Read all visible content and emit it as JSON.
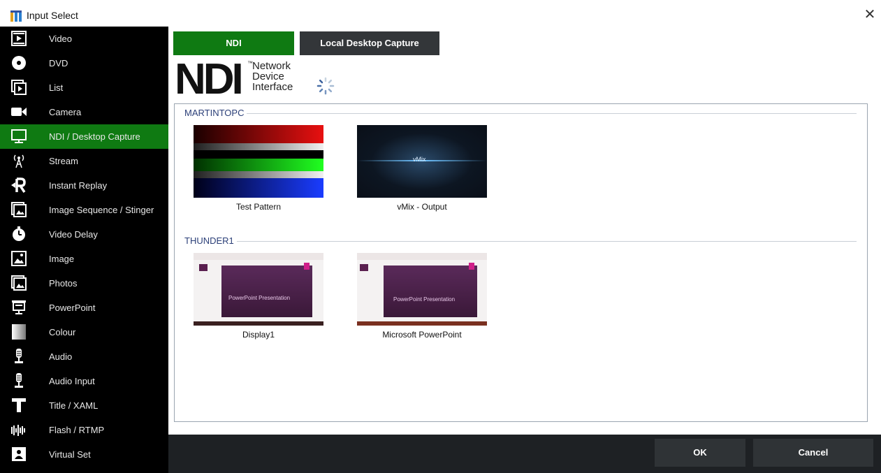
{
  "window": {
    "title": "Input Select",
    "close_glyph": "✕"
  },
  "sidebar": {
    "items": [
      {
        "label": "Video",
        "icon": "video-icon"
      },
      {
        "label": "DVD",
        "icon": "dvd-icon"
      },
      {
        "label": "List",
        "icon": "list-icon"
      },
      {
        "label": "Camera",
        "icon": "camera-icon"
      },
      {
        "label": "NDI / Desktop Capture",
        "icon": "monitor-icon",
        "active": true
      },
      {
        "label": "Stream",
        "icon": "antenna-icon"
      },
      {
        "label": "Instant Replay",
        "icon": "replay-icon"
      },
      {
        "label": "Image Sequence / Stinger",
        "icon": "image-sequence-icon"
      },
      {
        "label": "Video Delay",
        "icon": "timer-icon"
      },
      {
        "label": "Image",
        "icon": "image-icon"
      },
      {
        "label": "Photos",
        "icon": "photos-icon"
      },
      {
        "label": "PowerPoint",
        "icon": "presentation-icon"
      },
      {
        "label": "Colour",
        "icon": "colour-icon"
      },
      {
        "label": "Audio",
        "icon": "microphone-icon"
      },
      {
        "label": "Audio Input",
        "icon": "microphone-input-icon"
      },
      {
        "label": "Title / XAML",
        "icon": "title-icon"
      },
      {
        "label": "Flash / RTMP",
        "icon": "flash-icon"
      },
      {
        "label": "Virtual Set",
        "icon": "virtual-set-icon"
      }
    ]
  },
  "tabs": {
    "ndi": "NDI",
    "desktop": "Local Desktop Capture"
  },
  "logo": {
    "big": "NDI",
    "line1": "Network",
    "line2": "Device",
    "line3": "Interface",
    "tm": "™"
  },
  "groups": [
    {
      "name": "MARTINTOPC",
      "sources": [
        {
          "label": "Test Pattern"
        },
        {
          "label": "vMix - Output",
          "thumb_text": "vMix"
        }
      ]
    },
    {
      "name": "THUNDER1",
      "sources": [
        {
          "label": "Display1",
          "thumb_text": "PowerPoint Presentation"
        },
        {
          "label": "Microsoft PowerPoint",
          "thumb_text": "PowerPoint Presentation"
        }
      ]
    }
  ],
  "footer": {
    "ok": "OK",
    "cancel": "Cancel"
  },
  "colors": {
    "accent_green": "#0f7a12",
    "sidebar_bg": "#000000",
    "footer_bg": "#1e2124",
    "group_label": "#2b3f78"
  }
}
